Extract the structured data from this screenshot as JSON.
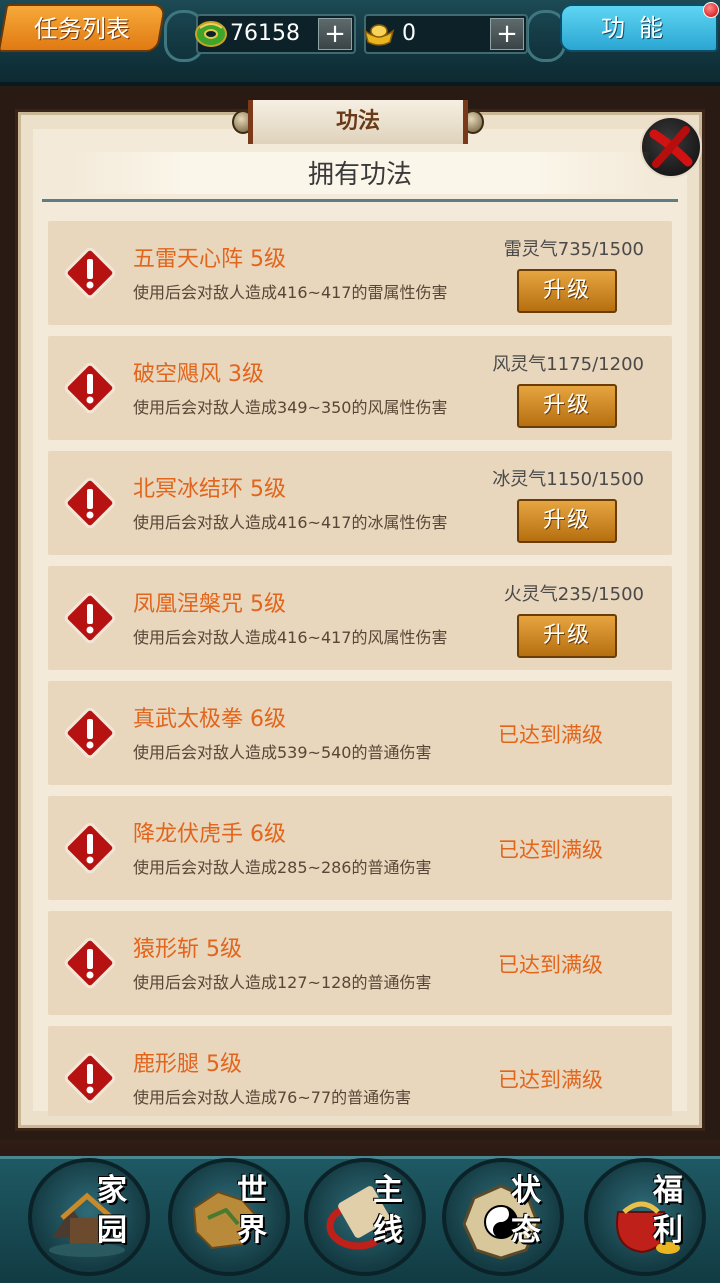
{
  "topbar": {
    "task_list_label": "任务列表",
    "function_label": "功能",
    "jade_amount": "76158",
    "gold_amount": "0",
    "plus": "+"
  },
  "panel": {
    "title": "功法",
    "subtitle": "拥有功法"
  },
  "skills": [
    {
      "name": "五雷天心阵 5级",
      "desc": "使用后会对敌人造成416~417的雷属性伤害",
      "qi": "雷灵气735/1500",
      "action": "升级"
    },
    {
      "name": "破空飓风 3级",
      "desc": "使用后会对敌人造成349~350的风属性伤害",
      "qi": "风灵气1175/1200",
      "action": "升级"
    },
    {
      "name": "北冥冰结环 5级",
      "desc": "使用后会对敌人造成416~417的冰属性伤害",
      "qi": "冰灵气1150/1500",
      "action": "升级"
    },
    {
      "name": "凤凰涅槃咒 5级",
      "desc": "使用后会对敌人造成416~417的风属性伤害",
      "qi": "火灵气235/1500",
      "action": "升级"
    },
    {
      "name": "真武太极拳 6级",
      "desc": "使用后会对敌人造成539~540的普通伤害",
      "status": "已达到满级"
    },
    {
      "name": "降龙伏虎手 6级",
      "desc": "使用后会对敌人造成285~286的普通伤害",
      "status": "已达到满级"
    },
    {
      "name": "猿形斩 5级",
      "desc": "使用后会对敌人造成127~128的普通伤害",
      "status": "已达到满级"
    },
    {
      "name": "鹿形腿 5级",
      "desc": "使用后会对敌人造成76~77的普通伤害",
      "status": "已达到满级"
    }
  ],
  "nav": [
    {
      "label_top": "家",
      "label_bottom": "园"
    },
    {
      "label_top": "世",
      "label_bottom": "界"
    },
    {
      "label_top": "主",
      "label_bottom": "线"
    },
    {
      "label_top": "状",
      "label_bottom": "态"
    },
    {
      "label_top": "福",
      "label_bottom": "利"
    }
  ],
  "colors": {
    "accent_orange": "#e2651c",
    "upgrade_button": "#c9841f",
    "teal_frame": "#1e5963"
  },
  "icons": {
    "jade": "jade-coin-icon",
    "gold": "gold-ingot-icon",
    "close": "close-x-icon",
    "skill": "warning-diamond-icon",
    "notification": "red-dot-icon"
  }
}
